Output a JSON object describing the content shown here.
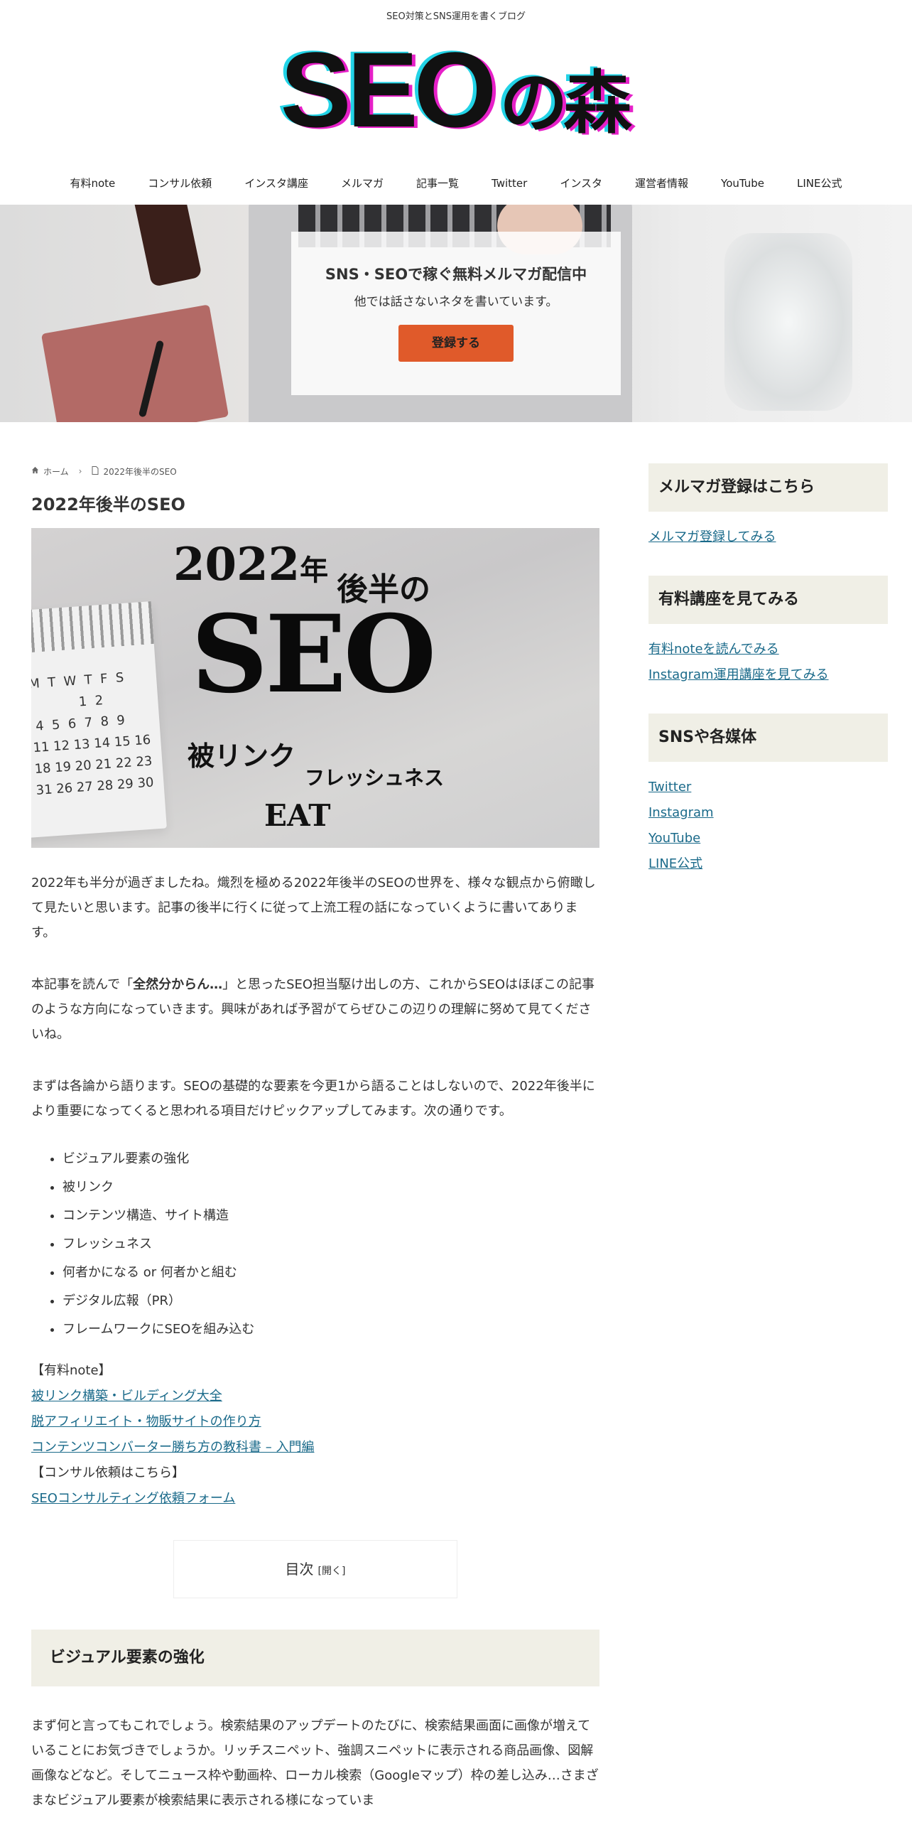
{
  "header": {
    "tagline": "SEO対策とSNS運用を書くブログ",
    "logo_text": "SEOの森",
    "nav": [
      "有料note",
      "コンサル依頼",
      "インスタ講座",
      "メルマガ",
      "記事一覧",
      "Twitter",
      "インスタ",
      "運営者情報",
      "YouTube",
      "LINE公式"
    ]
  },
  "hero": {
    "title": "SNS・SEOで稼ぐ無料メルマガ配信中",
    "subtitle": "他では話さないネタを書いています。",
    "button": "登録する"
  },
  "breadcrumb": {
    "home": "ホーム",
    "current": "2022年後半のSEO"
  },
  "article": {
    "title": "2022年後半のSEO",
    "eyecatch": {
      "year": "2022",
      "year_suffix": "年",
      "kohan": "後半の",
      "seo": "SEO",
      "link": "被リンク",
      "fresh": "フレッシュネス",
      "eat": "EAT"
    },
    "p1": "2022年も半分が過ぎましたね。熾烈を極める2022年後半のSEOの世界を、様々な観点から俯瞰して見たいと思います。記事の後半に行くに従って上流工程の話になっていくように書いてあります。",
    "p2_before": "本記事を読んで「",
    "p2_bold": "全然分からん…",
    "p2_after": "」と思ったSEO担当駆け出しの方、これからSEOはほぼこの記事のような方向になっていきます。興味があれば予習がてらぜひこの辺りの理解に努めて見てくださいね。",
    "p3": "まずは各論から語ります。SEOの基礎的な要素を今更1から語ることはしないので、2022年後半により重要になってくると思われる項目だけピックアップしてみます。次の通りです。",
    "bullets": [
      "ビジュアル要素の強化",
      "被リンク",
      "コンテンツ構造、サイト構造",
      "フレッシュネス",
      "何者かになる or 何者かと組む",
      "デジタル広報（PR）",
      "フレームワークにSEOを組み込む"
    ],
    "note_heading": "【有料note】",
    "note_links": [
      "被リンク構築・ビルディング大全",
      "脱アフィリエイト・物販サイトの作り方",
      "コンテンツコンバーター勝ち方の教科書 – 入門編"
    ],
    "consult_heading": "【コンサル依頼はこちら】",
    "consult_link": "SEOコンサルティング依頼フォーム",
    "toc_label": "目次",
    "toc_toggle": "[開く]",
    "h2": "ビジュアル要素の強化",
    "p4": "まず何と言ってもこれでしょう。検索結果のアップデートのたびに、検索結果画面に画像が増えていることにお気づきでしょうか。リッチスニペット、強調スニペットに表示される商品画像、図解画像などなど。そしてニュース枠や動画枠、ローカル検索（Googleマップ）枠の差し込み…さまざまなビジュアル要素が検索結果に表示される様になっていま"
  },
  "sidebar": {
    "widgets": [
      {
        "title": "メルマガ登録はこちら",
        "links": [
          "メルマガ登録してみる"
        ]
      },
      {
        "title": "有料講座を見てみる",
        "links": [
          "有料noteを読んでみる",
          "Instagram運用講座を見てみる"
        ]
      },
      {
        "title": "SNSや各媒体",
        "links": [
          "Twitter",
          "Instagram",
          "YouTube",
          "LINE公式"
        ]
      }
    ]
  },
  "colors": {
    "accent_button": "#e05a2a",
    "link": "#1a6a8a",
    "heading_bg": "#f0efe6",
    "logo_shadow_cyan": "#22d3e6",
    "logo_shadow_magenta": "#e620c8"
  }
}
